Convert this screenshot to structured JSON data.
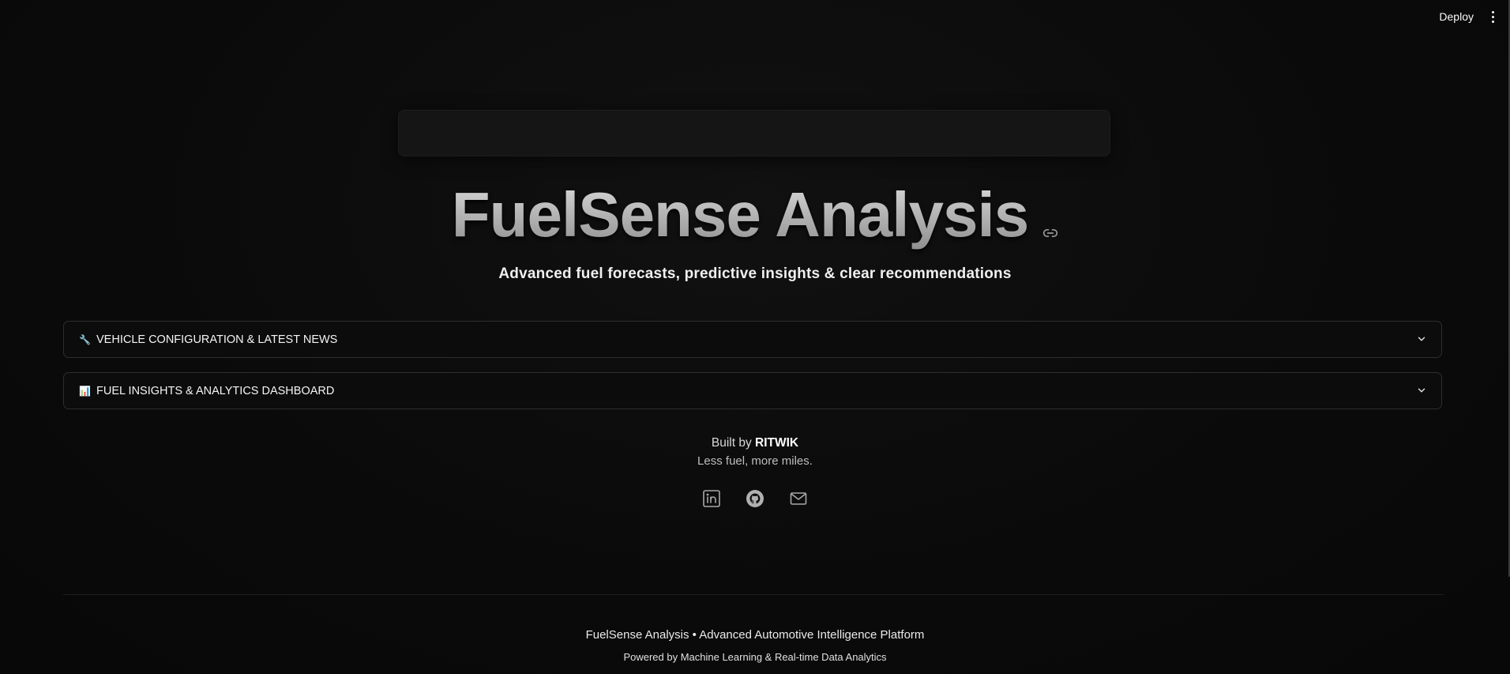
{
  "header": {
    "deploy_label": "Deploy",
    "menu_icon": "more-vertical-icon"
  },
  "hero": {
    "title": "FuelSense Analysis",
    "link_icon": "link-icon",
    "subtitle": "Advanced fuel forecasts, predictive insights & clear recommendations"
  },
  "expanders": [
    {
      "icon": "🔧",
      "icon_name": "wrench-icon",
      "label": "VEHICLE CONFIGURATION & LATEST NEWS",
      "expanded": false
    },
    {
      "icon": "📊",
      "icon_name": "bar-chart-icon",
      "label": "FUEL INSIGHTS & ANALYTICS DASHBOARD",
      "expanded": false
    }
  ],
  "credits": {
    "built_prefix": "Built by",
    "author": "RITWIK",
    "tagline": "Less fuel, more miles."
  },
  "socials": [
    {
      "name": "linkedin-icon"
    },
    {
      "name": "github-icon"
    },
    {
      "name": "mail-icon"
    }
  ],
  "footer": {
    "line1": "FuelSense Analysis • Advanced Automotive Intelligence Platform",
    "line2": "Powered by Machine Learning & Real-time Data Analytics"
  },
  "colors": {
    "background": "#0b0b0b",
    "border": "#2e2e2e",
    "text": "#ffffff"
  }
}
